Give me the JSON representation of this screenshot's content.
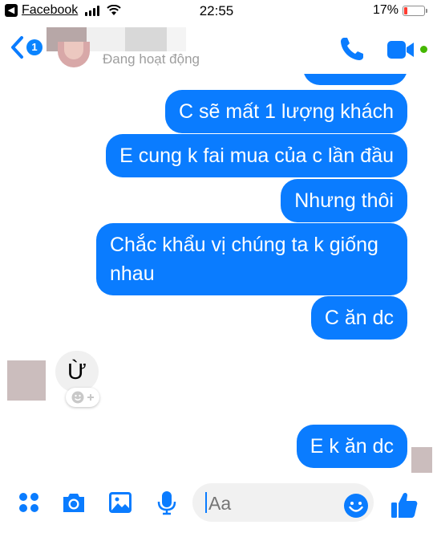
{
  "status_bar": {
    "back_app": "Facebook",
    "time": "22:55",
    "battery_percent": "17%",
    "battery_level": 0.17,
    "signal_bars": 4
  },
  "header": {
    "unread_count": "1",
    "contact_status": "Đang hoạt động"
  },
  "messages": {
    "outgoing": [
      "C sẽ mất 1 lượng khách",
      "E cung k fai mua của c lần đầu",
      "Nhưng thôi",
      "Chắc khẩu vị chúng ta k giống nhau",
      "C ăn dc",
      "E k ăn dc"
    ],
    "incoming": [
      "Ừ"
    ]
  },
  "composer": {
    "placeholder": "Aa"
  },
  "colors": {
    "accent": "#0a7cff",
    "online": "#44b700",
    "battery_low": "#ff3b30"
  },
  "icons": [
    "back-chevron-icon",
    "phone-icon",
    "video-camera-icon",
    "apps-grid-icon",
    "camera-icon",
    "photo-icon",
    "microphone-icon",
    "emoji-icon",
    "thumbs-up-icon",
    "add-reaction-icon"
  ]
}
